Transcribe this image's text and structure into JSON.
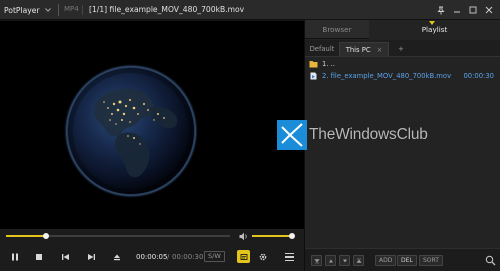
{
  "titlebar": {
    "app_name": "PotPlayer",
    "format": "MP4",
    "window_title": "[1/1] file_example_MOV_480_700kB.mov"
  },
  "player": {
    "time_current": "00:00:05",
    "time_separator": "/",
    "time_total": "00:00:30",
    "sw_label": "S/W",
    "seek_progress": 0.18,
    "volume_level": 0.95
  },
  "panel": {
    "tabs": [
      {
        "label": "Browser",
        "active": false
      },
      {
        "label": "Playlist",
        "active": true
      }
    ],
    "subtabs": {
      "default": "Default",
      "this_pc": "This PC",
      "close": "×",
      "add": "+"
    },
    "items": [
      {
        "label": "1. ..",
        "type": "folder",
        "duration": ""
      },
      {
        "label": "2. file_example_MOV_480_700kB.mov",
        "type": "video",
        "duration": "00:00:30"
      }
    ],
    "buttons": {
      "add": "ADD",
      "del": "DEL",
      "sort": "SORT"
    }
  },
  "watermark": {
    "text": "TheWindowsClub"
  },
  "colors": {
    "accent": "#e3c51b",
    "link": "#5aa2e8",
    "watermark_logo": "#1b8cd8"
  }
}
